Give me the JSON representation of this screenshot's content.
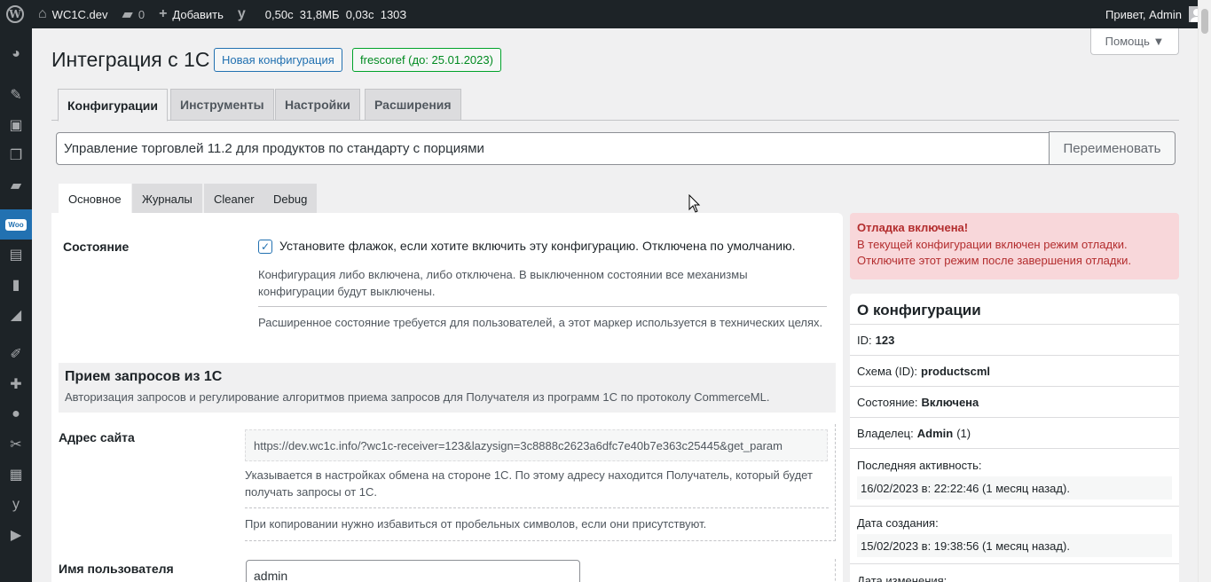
{
  "admin_bar": {
    "site_name": "WC1C.dev",
    "comments_count": "0",
    "add_label": "Добавить",
    "perf_stats": "0,50с  31,8МБ  0,03с  130З",
    "greeting": "Привет, Admin"
  },
  "help": {
    "label": "Помощь ▼"
  },
  "header": {
    "title": "Интеграция с 1С",
    "new_config_badge": "Новая конфигурация",
    "license_badge": "frescoref (до: 25.01.2023)"
  },
  "main_tabs": [
    {
      "label": "Конфигурации",
      "active": true
    },
    {
      "label": "Инструменты",
      "active": false
    },
    {
      "label": "Настройки",
      "active": false
    },
    {
      "label": "Расширения",
      "active": false
    }
  ],
  "config": {
    "name_value": "Управление торговлей 11.2 для продуктов по стандарту с порциями",
    "rename_label": "Переименовать"
  },
  "sub_tabs": [
    {
      "label": "Основное",
      "active": true
    },
    {
      "label": "Журналы",
      "active": false
    },
    {
      "label": "Cleaner",
      "active": false
    },
    {
      "label": "Debug",
      "active": false
    }
  ],
  "form": {
    "state": {
      "label": "Состояние",
      "checked": true,
      "checkbox_text": "Установите флажок, если хотите включить эту конфигурацию. Отключена по умолчанию.",
      "desc1": "Конфигурация либо включена, либо отключена. В выключенном состоянии все механизмы конфигурации будут выключены.",
      "desc2": "Расширенное состояние требуется для пользователей, а этот маркер используется в технических целях."
    },
    "section": {
      "title": "Прием запросов из 1С",
      "desc": "Авторизация запросов и регулирование алгоритмов приема запросов для Получателя из программ 1С по протоколу CommerceML."
    },
    "site_url": {
      "label": "Адрес сайта",
      "value": "https://dev.wc1c.info/?wc1c-receiver=123&lazysign=3c8888c2623a6dfc7e40b7e363c25445&get_param",
      "desc1": "Указывается в настройках обмена на стороне 1С. По этому адресу находится Получатель, который будет получать запросы от 1С.",
      "desc2": "При копировании нужно избавиться от пробельных символов, если они присутствуют."
    },
    "username": {
      "label": "Имя пользователя",
      "value": "admin"
    }
  },
  "notice": {
    "title": "Отладка включена!",
    "body": "В текущей конфигурации включен режим отладки. Отключите этот режим после завершения отладки."
  },
  "about": {
    "title": "О конфигурации",
    "id_label": "ID:",
    "id_value": "123",
    "schema_label": "Схема (ID):",
    "schema_value": "productscml",
    "status_label": "Состояние:",
    "status_value": "Включена",
    "owner_label": "Владелец:",
    "owner_value": "Admin",
    "owner_id": "(1)",
    "last_activity_label": "Последняя активность:",
    "last_activity_value": "16/02/2023 в: 22:22:46 (1 месяц назад).",
    "created_label": "Дата создания:",
    "created_value": "15/02/2023 в: 19:38:56 (1 месяц назад).",
    "modified_label": "Дата изменения:"
  },
  "icons": {
    "sidebar": [
      "dashboard-icon",
      "pin-icon",
      "media-icon",
      "pages-icon",
      "comments-icon",
      "woo-icon",
      "products-icon",
      "analytics-icon",
      "marketing-icon",
      "appearance-icon",
      "plugins-icon",
      "users-icon",
      "tools-icon",
      "integration-icon",
      "yoast-icon",
      "play-icon"
    ]
  },
  "colors": {
    "admin_bar": "#1d2327",
    "accent": "#2271b1",
    "license_green": "#00a32a",
    "notice_bg": "#f8d7da",
    "notice_text": "#b32d2e"
  }
}
